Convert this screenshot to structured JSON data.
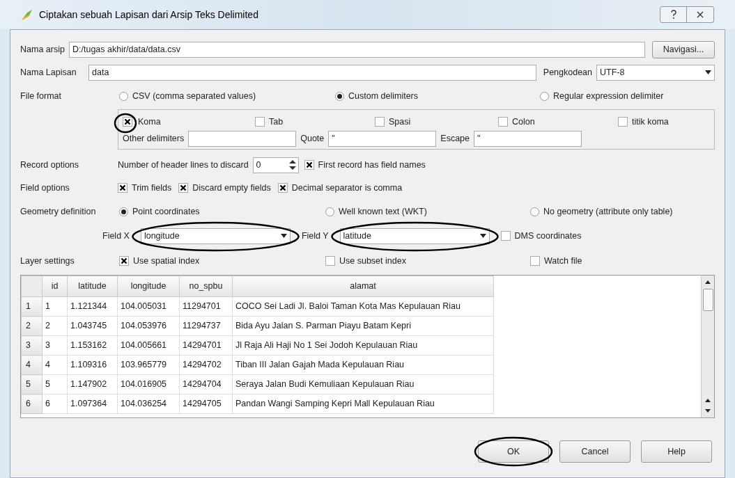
{
  "window": {
    "title": "Ciptakan sebuah Lapisan dari Arsip Teks Delimited"
  },
  "file": {
    "label": "Nama arsip",
    "value": "D:/tugas akhir/data/data.csv",
    "browse_button": "Navigasi..."
  },
  "layer": {
    "label": "Nama Lapisan",
    "value": "data",
    "encoding_label": "Pengkodean",
    "encoding_value": "UTF-8"
  },
  "file_format": {
    "label": "File format",
    "options": [
      {
        "label": "CSV (comma separated values)",
        "selected": false
      },
      {
        "label": "Custom delimiters",
        "selected": true
      },
      {
        "label": "Regular expression delimiter",
        "selected": false
      }
    ]
  },
  "delimiters": [
    {
      "label": "Koma",
      "checked": true
    },
    {
      "label": "Tab",
      "checked": false
    },
    {
      "label": "Spasi",
      "checked": false
    },
    {
      "label": "Colon",
      "checked": false
    },
    {
      "label": "titik koma",
      "checked": false
    }
  ],
  "other_delimiters": {
    "label": "Other delimiters"
  },
  "quote": {
    "label": "Quote",
    "value": "\""
  },
  "escape": {
    "label": "Escape",
    "value": "\""
  },
  "record_options": {
    "label": "Record options",
    "header_lines_label": "Number of header lines to discard",
    "header_lines_value": "0",
    "first_record": {
      "label": "First record has field names",
      "checked": true
    }
  },
  "field_options": {
    "label": "Field options",
    "options": [
      {
        "label": "Trim fields",
        "checked": true
      },
      {
        "label": "Discard empty fields",
        "checked": true
      },
      {
        "label": "Decimal separator is comma",
        "checked": true
      }
    ]
  },
  "geometry": {
    "label": "Geometry definition",
    "options": [
      {
        "label": "Point coordinates",
        "selected": true
      },
      {
        "label": "Well known text (WKT)",
        "selected": false
      },
      {
        "label": "No geometry (attribute only table)",
        "selected": false
      }
    ],
    "field_x": {
      "label": "Field X",
      "value": "longitude"
    },
    "field_y": {
      "label": "Field Y",
      "value": "latitude"
    },
    "dms": {
      "label": "DMS coordinates",
      "checked": false
    }
  },
  "layer_settings": {
    "label": "Layer settings",
    "options": [
      {
        "label": "Use spatial index",
        "checked": true
      },
      {
        "label": "Use subset index",
        "checked": false
      },
      {
        "label": "Watch file",
        "checked": false
      }
    ]
  },
  "table": {
    "columns": [
      "id",
      "latitude",
      "longitude",
      "no_spbu",
      "alamat"
    ],
    "rows": [
      {
        "header": "1",
        "cells": [
          "1",
          "1.121344",
          "104.005031",
          "11294701",
          "COCO Sei Ladi Jl. Baloi Taman Kota Mas Kepulauan Riau"
        ]
      },
      {
        "header": "2",
        "cells": [
          "2",
          "1.043745",
          "104.053976",
          "11294737",
          "Bida Ayu Jalan S. Parman Piayu Batam Kepri"
        ]
      },
      {
        "header": "3",
        "cells": [
          "3",
          "1.153162",
          "104.005661",
          "14294701",
          "Jl Raja Ali Haji No 1 Sei Jodoh Kepulauan Riau"
        ]
      },
      {
        "header": "4",
        "cells": [
          "4",
          "1.109316",
          "103.965779",
          "14294702",
          "Tiban III Jalan Gajah Mada Kepulauan Riau"
        ]
      },
      {
        "header": "5",
        "cells": [
          "5",
          "1.147902",
          "104.016905",
          "14294704",
          "Seraya Jalan Budi Kemuliaan Kepulauan Riau"
        ]
      },
      {
        "header": "6",
        "cells": [
          "6",
          "1.097364",
          "104.036254",
          "14294705",
          "Pandan Wangi Samping Kepri Mall Kepulauan Riau"
        ]
      }
    ]
  },
  "buttons": [
    {
      "label": "OK"
    },
    {
      "label": "Cancel"
    },
    {
      "label": "Help"
    }
  ]
}
